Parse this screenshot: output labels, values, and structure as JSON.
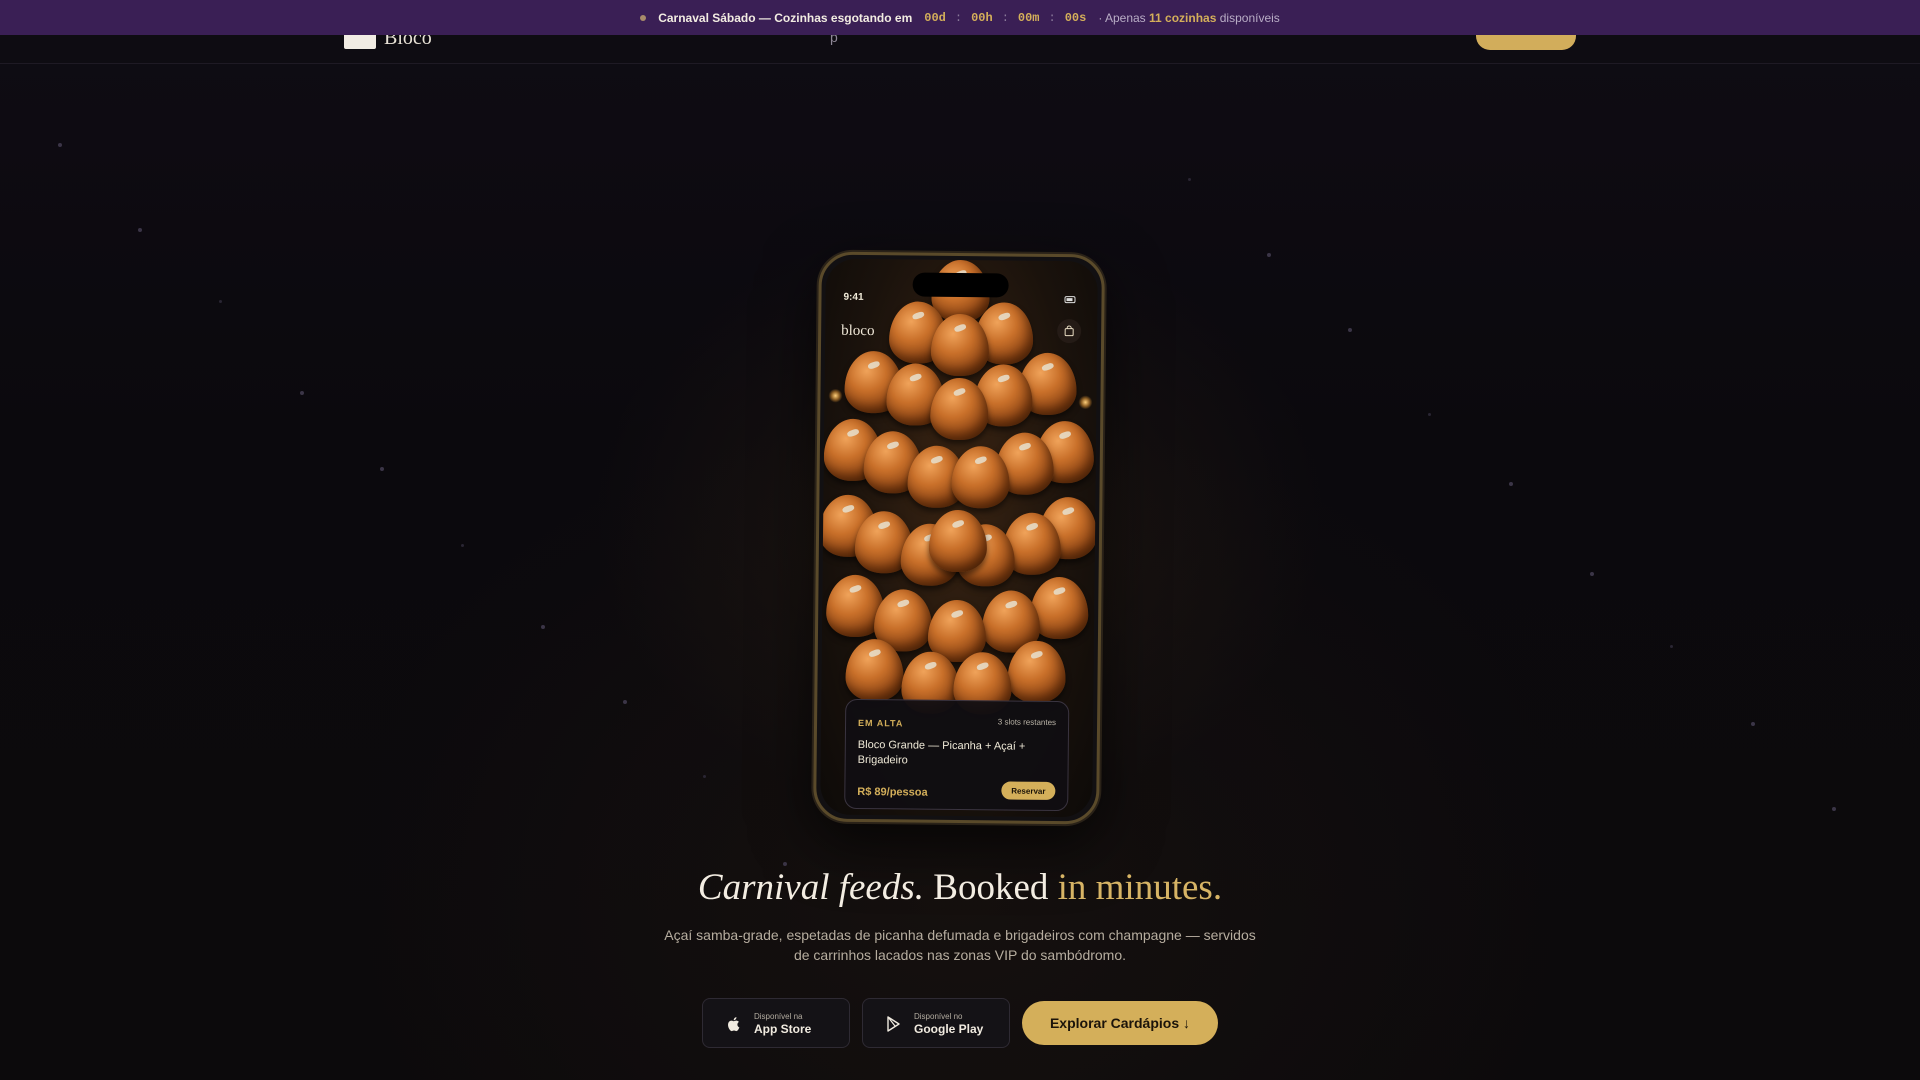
{
  "banner": {
    "event": "Carnaval Sábado — Cozinhas esgotando em",
    "countdown": {
      "days": "00d",
      "hours": "00h",
      "minutes": "00m",
      "seconds": "00s"
    },
    "separator": ":",
    "avail_prefix": "· Apenas",
    "avail_count": "11 cozinhas",
    "avail_suffix": "disponíveis"
  },
  "nav": {
    "logo_text": "Bloco",
    "mid_text": "p"
  },
  "phone": {
    "status_time": "9:41",
    "app_name": "bloco",
    "card": {
      "tag": "EM ALTA",
      "slots": "3 slots restantes",
      "title": "Bloco Grande — Picanha + Açaí + Brigadeiro",
      "price": "R$ 89/pessoa",
      "button": "Reservar"
    }
  },
  "hero": {
    "headline_italic": "Carnival feeds.",
    "headline_plain": "Booked",
    "headline_gold": "in minutes.",
    "subtitle": "Açaí samba-grade, espetadas de picanha defumada e brigadeiros com champagne — servidos de carrinhos lacados nas zonas VIP do sambódromo."
  },
  "stores": {
    "app_store_small": "Disponível na",
    "app_store_big": "App Store",
    "google_small": "Disponível no",
    "google_big": "Google Play"
  },
  "cta": {
    "explore": "Explorar Cardápios ↓"
  },
  "icons": [
    "apple-icon",
    "google-play-icon",
    "bag-icon",
    "battery-icon"
  ],
  "colors": {
    "accent_gold": "#d4af5a",
    "banner_purple": "#3a1f55",
    "background": "#0b090d"
  }
}
